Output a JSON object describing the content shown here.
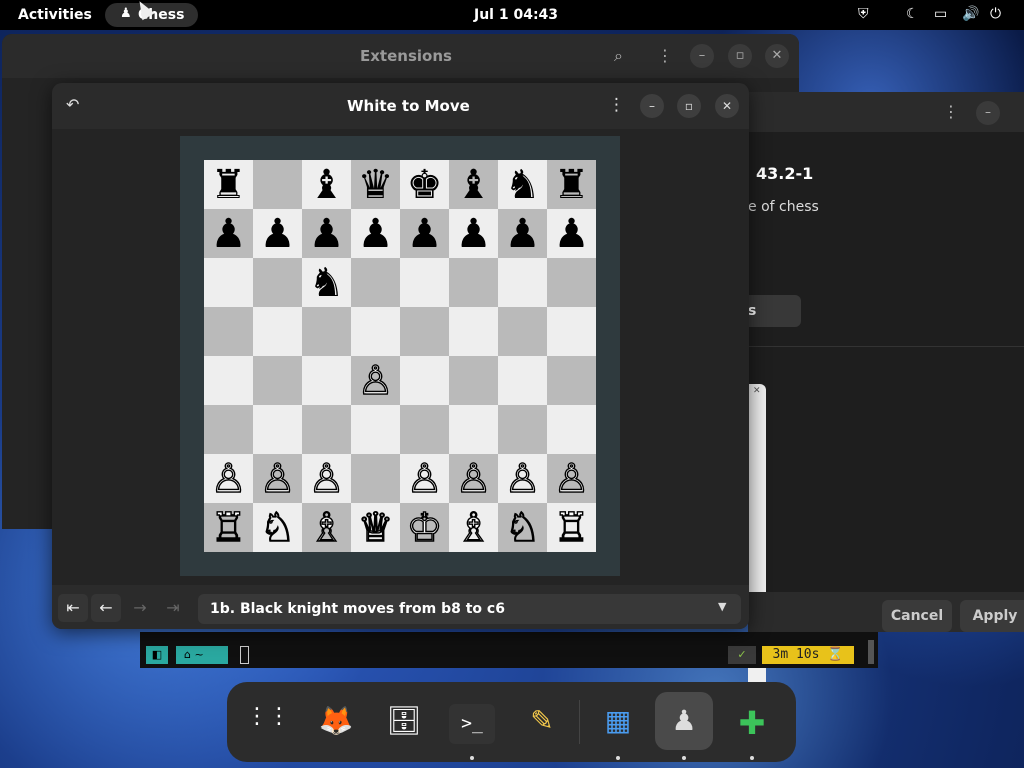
{
  "topbar": {
    "activities": "Activities",
    "app_name": "Chess",
    "app_icon": "chess-pawn-icon",
    "clock": "Jul 1  04:43",
    "tray_icons": [
      "shield-icon",
      "moon-icon",
      "screen-icon",
      "volume-icon",
      "power-icon"
    ]
  },
  "extensions_window": {
    "title": "Extensions"
  },
  "right_window": {
    "version": "43.2-1",
    "description": "e of chess",
    "button": "s",
    "cancel": "Cancel",
    "apply": "Apply"
  },
  "chess": {
    "title": "White to Move",
    "board": [
      [
        "♜",
        "",
        "♝",
        "♛",
        "♚",
        "♝",
        "♞",
        "♜"
      ],
      [
        "♟",
        "♟",
        "♟",
        "♟",
        "♟",
        "♟",
        "♟",
        "♟"
      ],
      [
        "",
        "",
        "♞",
        "",
        "",
        "",
        "",
        ""
      ],
      [
        "",
        "",
        "",
        "",
        "",
        "",
        "",
        ""
      ],
      [
        "",
        "",
        "",
        "♙",
        "",
        "",
        "",
        ""
      ],
      [
        "",
        "",
        "",
        "",
        "",
        "",
        "",
        ""
      ],
      [
        "♙",
        "♙",
        "♙",
        "",
        "♙",
        "♙",
        "♙",
        "♙"
      ],
      [
        "♖",
        "♘",
        "♗",
        "♕",
        "♔",
        "♗",
        "♘",
        "♖"
      ]
    ],
    "history": "1b. Black knight moves from b8 to c6",
    "nav": [
      "first-move-icon",
      "prev-move-icon",
      "next-move-icon",
      "last-move-icon"
    ]
  },
  "terminal": {
    "scrollback": "...  ....  ....  .........  ...  .....  ...  ...........",
    "prompt_home": "~",
    "timer": "3m 10s ⌛"
  },
  "dock": {
    "apps": [
      {
        "name": "app-grid",
        "glyph": "⋮⋮"
      },
      {
        "name": "firefox",
        "glyph": "🦊"
      },
      {
        "name": "files",
        "glyph": "🗄"
      },
      {
        "name": "terminal",
        "glyph": ">_"
      },
      {
        "name": "text-editor",
        "glyph": "✎"
      },
      {
        "name": "software",
        "glyph": "▦"
      },
      {
        "name": "chess",
        "glyph": "♟"
      },
      {
        "name": "extensions",
        "glyph": "✚"
      }
    ]
  }
}
